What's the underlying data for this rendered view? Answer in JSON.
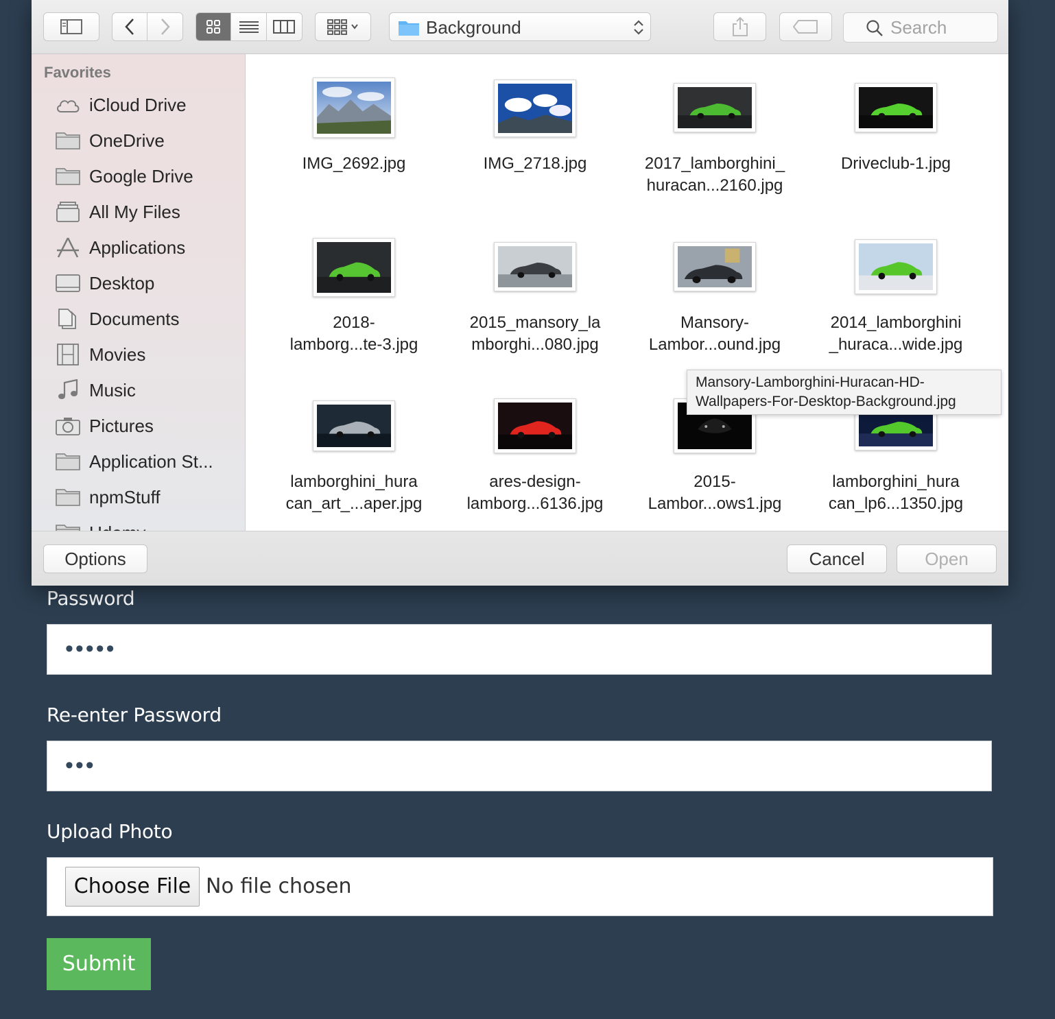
{
  "form": {
    "password_label": "Password",
    "password_value": "•••••",
    "reenter_label": "Re-enter Password",
    "reenter_value": "•••",
    "upload_label": "Upload Photo",
    "choose_file": "Choose File",
    "no_file": "No file chosen",
    "submit": "Submit"
  },
  "dialog": {
    "current_folder": "Background",
    "search_placeholder": "Search",
    "sidebar": {
      "heading": "Favorites",
      "items": [
        {
          "label": "iCloud Drive",
          "icon": "cloud-icon"
        },
        {
          "label": "OneDrive",
          "icon": "folder-icon"
        },
        {
          "label": "Google Drive",
          "icon": "folder-icon"
        },
        {
          "label": "All My Files",
          "icon": "all-files-icon"
        },
        {
          "label": "Applications",
          "icon": "applications-icon"
        },
        {
          "label": "Desktop",
          "icon": "desktop-icon"
        },
        {
          "label": "Documents",
          "icon": "documents-icon"
        },
        {
          "label": "Movies",
          "icon": "film-icon"
        },
        {
          "label": "Music",
          "icon": "music-note-icon"
        },
        {
          "label": "Pictures",
          "icon": "camera-icon"
        },
        {
          "label": "Application St...",
          "icon": "folder-icon"
        },
        {
          "label": "npmStuff",
          "icon": "folder-icon"
        },
        {
          "label": "Udemy",
          "icon": "folder-icon"
        }
      ]
    },
    "files": [
      {
        "line1": "IMG_2692.jpg",
        "line2": "",
        "thumb": "mountain"
      },
      {
        "line1": "IMG_2718.jpg",
        "line2": "",
        "thumb": "sky"
      },
      {
        "line1": "2017_lamborghini_",
        "line2": "huracan...2160.jpg",
        "thumb": "green-dark"
      },
      {
        "line1": "Driveclub-1.jpg",
        "line2": "",
        "thumb": "green-black"
      },
      {
        "line1": "2018-",
        "line2": "lamborg...te-3.jpg",
        "thumb": "green-front"
      },
      {
        "line1": "2015_mansory_la",
        "line2": "mborghi...080.jpg",
        "thumb": "grey-car"
      },
      {
        "line1": "Mansory-",
        "line2": "Lambor...ound.jpg",
        "thumb": "mansory"
      },
      {
        "line1": "2014_lamborghini",
        "line2": "_huraca...wide.jpg",
        "thumb": "green-bright"
      },
      {
        "line1": "lamborghini_hura",
        "line2": "can_art_...aper.jpg",
        "thumb": "silver"
      },
      {
        "line1": "ares-design-",
        "line2": "lamborg...6136.jpg",
        "thumb": "red"
      },
      {
        "line1": "2015-",
        "line2": "Lambor...ows1.jpg",
        "thumb": "black"
      },
      {
        "line1": "lamborghini_hura",
        "line2": "can_lp6...1350.jpg",
        "thumb": "city"
      }
    ],
    "tooltip_line1": "Mansory-Lamborghini-Huracan-HD-",
    "tooltip_line2": "Wallpapers-For-Desktop-Background.jpg",
    "options_button": "Options",
    "cancel_button": "Cancel",
    "open_button": "Open"
  },
  "colors": {
    "page_bg": "#2c3e50",
    "submit_green": "#5cb85c",
    "folder_blue": "#62b5f5"
  }
}
